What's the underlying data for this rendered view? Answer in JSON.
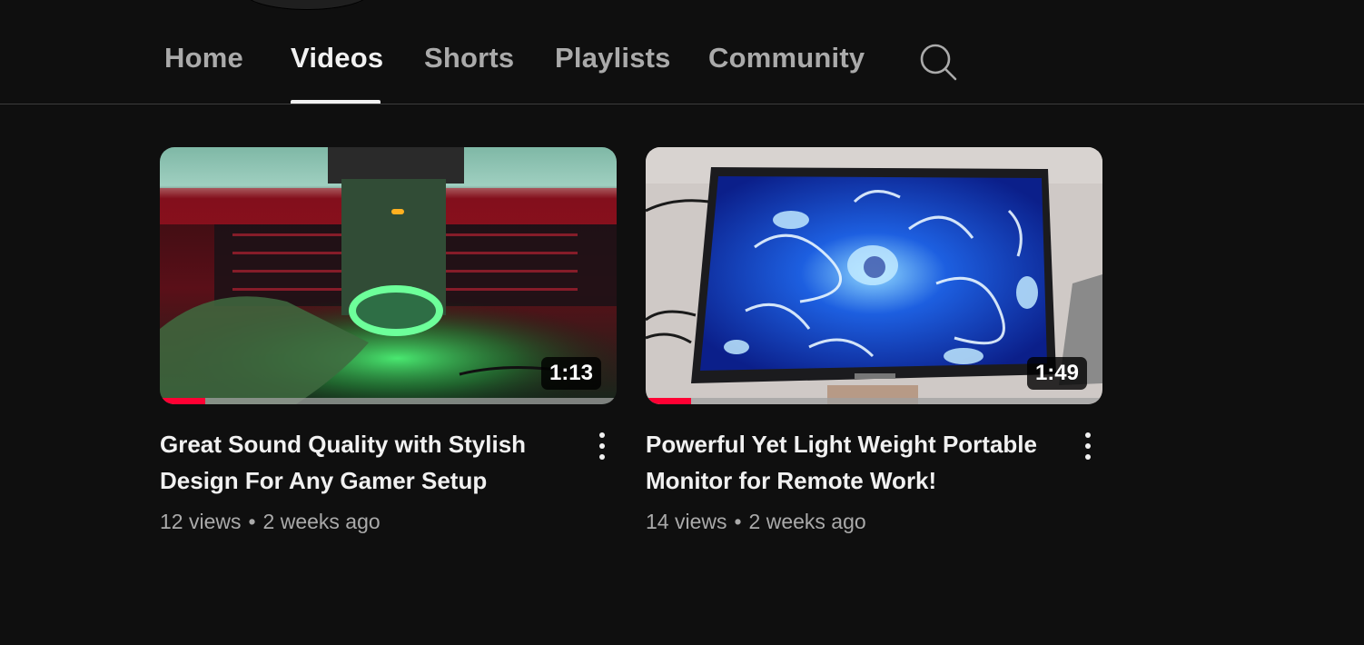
{
  "tabs": [
    {
      "label": "Home"
    },
    {
      "label": "Videos",
      "active": true
    },
    {
      "label": "Shorts"
    },
    {
      "label": "Playlists"
    },
    {
      "label": "Community"
    }
  ],
  "search": {
    "icon": "search-icon"
  },
  "videos": [
    {
      "title": "Great Sound Quality with Stylish Design For Any Gamer Setup",
      "views": "12 views",
      "separator": "•",
      "age": "2 weeks ago",
      "duration": "1:13",
      "watched_progress": 0.1,
      "menu_icon": "more-vert-icon"
    },
    {
      "title": "Powerful Yet Light Weight Portable Monitor for Remote Work!",
      "views": "14 views",
      "separator": "•",
      "age": "2 weeks ago",
      "duration": "1:49",
      "watched_progress": 0.1,
      "menu_icon": "more-vert-icon"
    }
  ],
  "colors": {
    "background": "#0f0f0f",
    "progress": "#ff0033",
    "text_primary": "#f1f1f1",
    "text_secondary": "#aaaaaa"
  }
}
